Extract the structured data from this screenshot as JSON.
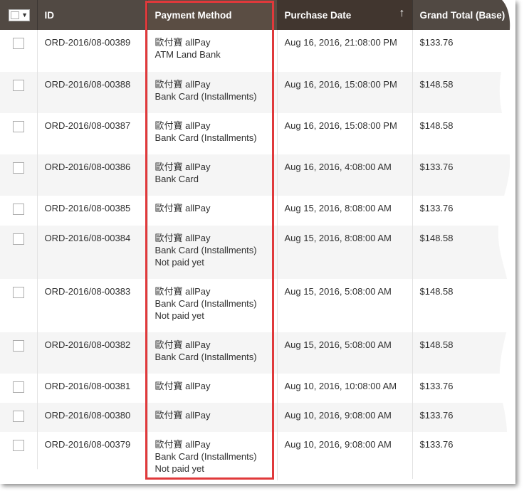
{
  "columns": {
    "id": "ID",
    "payment_method": "Payment Method",
    "purchase_date": "Purchase Date",
    "grand_total": "Grand Total (Base)",
    "sort_indicator": "↑"
  },
  "rows": [
    {
      "id": "ORD-2016/08-00389",
      "payment": [
        "歐付寶 allPay",
        "ATM Land Bank"
      ],
      "date": "Aug 16, 2016, 21:08:00 PM",
      "total": "$133.76"
    },
    {
      "id": "ORD-2016/08-00388",
      "payment": [
        "歐付寶 allPay",
        "Bank Card (Installments)"
      ],
      "date": "Aug 16, 2016, 15:08:00 PM",
      "total": "$148.58"
    },
    {
      "id": "ORD-2016/08-00387",
      "payment": [
        "歐付寶 allPay",
        "Bank Card (Installments)"
      ],
      "date": "Aug 16, 2016, 15:08:00 PM",
      "total": "$148.58"
    },
    {
      "id": "ORD-2016/08-00386",
      "payment": [
        "歐付寶 allPay",
        "Bank Card"
      ],
      "date": "Aug 16, 2016, 4:08:00 AM",
      "total": "$133.76"
    },
    {
      "id": "ORD-2016/08-00385",
      "payment": [
        "歐付寶 allPay"
      ],
      "date": "Aug 15, 2016, 8:08:00 AM",
      "total": "$133.76"
    },
    {
      "id": "ORD-2016/08-00384",
      "payment": [
        "歐付寶 allPay",
        "Bank Card (Installments)",
        "Not paid yet"
      ],
      "date": "Aug 15, 2016, 8:08:00 AM",
      "total": "$148.58"
    },
    {
      "id": "ORD-2016/08-00383",
      "payment": [
        "歐付寶 allPay",
        "Bank Card (Installments)",
        "Not paid yet"
      ],
      "date": "Aug 15, 2016, 5:08:00 AM",
      "total": "$148.58"
    },
    {
      "id": "ORD-2016/08-00382",
      "payment": [
        "歐付寶 allPay",
        "Bank Card (Installments)"
      ],
      "date": "Aug 15, 2016, 5:08:00 AM",
      "total": "$148.58"
    },
    {
      "id": "ORD-2016/08-00381",
      "payment": [
        "歐付寶 allPay"
      ],
      "date": "Aug 10, 2016, 10:08:00 AM",
      "total": "$133.76"
    },
    {
      "id": "ORD-2016/08-00380",
      "payment": [
        "歐付寶 allPay"
      ],
      "date": "Aug 10, 2016, 9:08:00 AM",
      "total": "$133.76"
    },
    {
      "id": "ORD-2016/08-00379",
      "payment": [
        "歐付寶 allPay",
        "Bank Card (Installments)",
        "Not paid yet"
      ],
      "date": "Aug 10, 2016, 9:08:00 AM",
      "total": "$133.76"
    }
  ],
  "colors": {
    "header_bg": "#514943",
    "highlight": "#e0393b",
    "row_alt": "#f5f5f5"
  }
}
